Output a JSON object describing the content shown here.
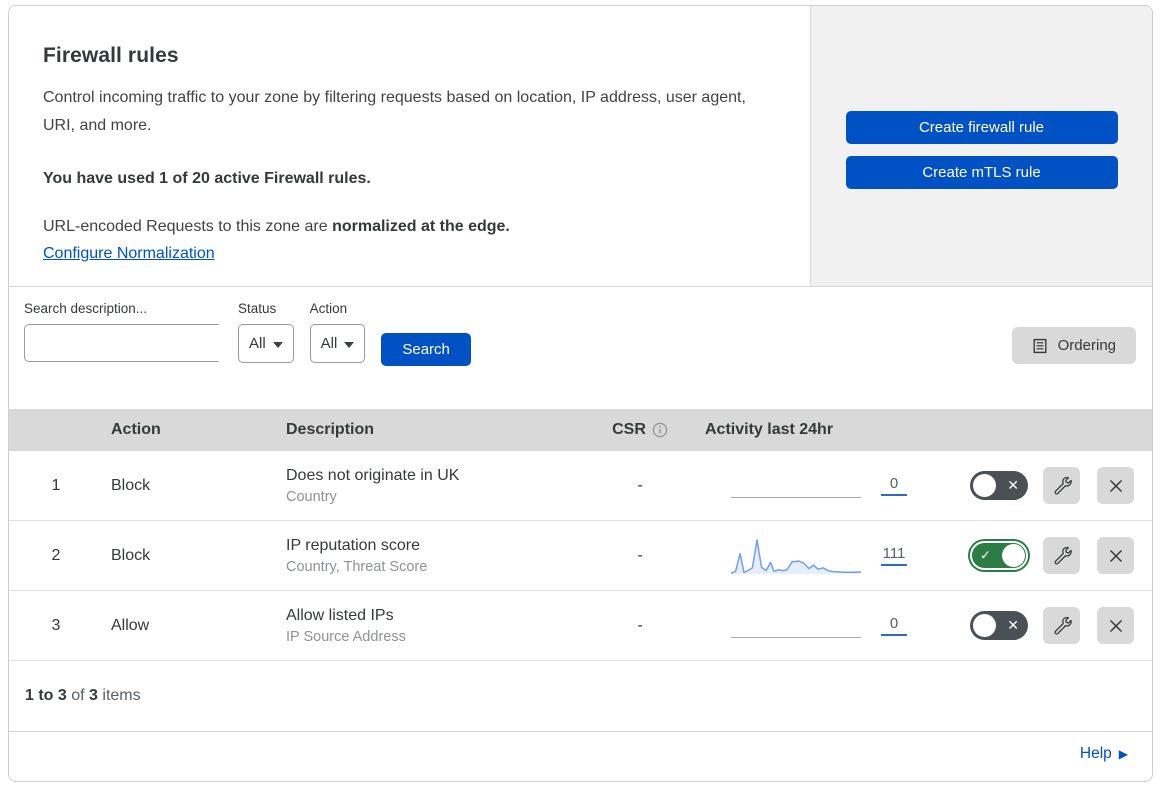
{
  "header": {
    "title": "Firewall rules",
    "description": "Control incoming traffic to your zone by filtering requests based on location, IP address, user agent, URI, and more.",
    "usage_text": "You have used 1 of 20 active Firewall rules.",
    "normalization_prefix": "URL-encoded Requests to this zone are ",
    "normalization_bold": "normalized at the edge.",
    "normalization_link": "Configure Normalization",
    "create_firewall_button": "Create firewall rule",
    "create_mtls_button": "Create mTLS rule"
  },
  "filters": {
    "search_label": "Search description...",
    "status_label": "Status",
    "status_value": "All",
    "action_label": "Action",
    "action_value": "All",
    "search_button": "Search",
    "ordering_button": "Ordering"
  },
  "table": {
    "columns": {
      "action": "Action",
      "description": "Description",
      "csr": "CSR",
      "activity": "Activity last 24hr"
    },
    "rows": [
      {
        "index": "1",
        "action": "Block",
        "description": "Does not originate in UK",
        "criteria": "Country",
        "csr": "-",
        "activity_count": "0",
        "enabled": false,
        "has_sparkline": false
      },
      {
        "index": "2",
        "action": "Block",
        "description": "IP reputation score",
        "criteria": "Country, Threat Score",
        "csr": "-",
        "activity_count": "111",
        "enabled": true,
        "has_sparkline": true
      },
      {
        "index": "3",
        "action": "Allow",
        "description": "Allow listed IPs",
        "criteria": "IP Source Address",
        "csr": "-",
        "activity_count": "0",
        "enabled": false,
        "has_sparkline": false
      }
    ],
    "toggle_check_glyph": "✓",
    "toggle_cross_glyph": "✕"
  },
  "chart_data": {
    "type": "area",
    "title": "Activity last 24hr sparkline (rule 2)",
    "x_normalized": [
      0,
      0.035,
      0.07,
      0.1,
      0.13,
      0.165,
      0.2,
      0.235,
      0.27,
      0.305,
      0.33,
      0.365,
      0.4,
      0.43,
      0.47,
      0.52,
      0.56,
      0.6,
      0.635,
      0.67,
      0.71,
      0.75,
      0.79,
      0.84,
      0.89,
      0.95,
      1
    ],
    "values_normalized": [
      0.02,
      0.08,
      0.6,
      0.04,
      0.1,
      0.18,
      1.0,
      0.2,
      0.1,
      0.34,
      0.08,
      0.12,
      0.1,
      0.12,
      0.36,
      0.38,
      0.32,
      0.16,
      0.26,
      0.14,
      0.18,
      0.09,
      0.07,
      0.06,
      0.05,
      0.05,
      0.06
    ],
    "total_label": "111",
    "line_color": "#6f9ff0",
    "fill_color": "#e7eefb"
  },
  "footer": {
    "range_bold": "1 to 3",
    "of_text": " of ",
    "total_bold": "3",
    "items_text": " items",
    "help_label": "Help",
    "help_arrow": "▶"
  },
  "colors": {
    "accent_blue": "#0051c3",
    "toggle_on_green": "#2c7c45",
    "toggle_off_gray": "#4a5055",
    "panel_gray": "#f1f1f1",
    "header_strip_gray": "#d9d9d9"
  }
}
